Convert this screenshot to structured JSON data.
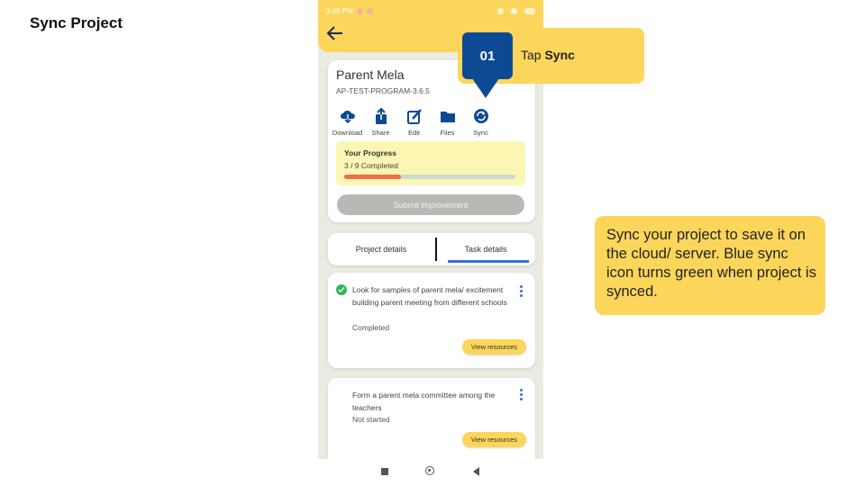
{
  "slide": {
    "title": "Sync Project"
  },
  "statusbar": {
    "time": "3:48 PM"
  },
  "project": {
    "title": "Parent Mela",
    "code": "AP-TEST-PROGRAM-3.6.5",
    "actions": [
      {
        "label": "Download",
        "icon": "cloud-download-icon"
      },
      {
        "label": "Share",
        "icon": "share-icon"
      },
      {
        "label": "Edit",
        "icon": "edit-icon"
      },
      {
        "label": "Files",
        "icon": "folder-icon"
      },
      {
        "label": "Sync",
        "icon": "sync-icon"
      }
    ],
    "progress": {
      "title": "Your Progress",
      "count_text": "3 / 9 Completed",
      "completed": 3,
      "total": 9
    },
    "submit_label": "Submit improvement"
  },
  "tabs": {
    "project": "Project details",
    "task": "Task details",
    "active": "task"
  },
  "tasks": [
    {
      "text": "Look for samples of parent mela/ excitement building parent meeting from different schools",
      "status": "Completed",
      "button": "View resources"
    },
    {
      "text": "Form a parent mela committee among the teachers",
      "status": "Not started",
      "button": "View resources"
    }
  ],
  "callouts": {
    "step_number": "01",
    "step_prefix": "Tap ",
    "step_action": "Sync",
    "info": "Sync your project to save it on the cloud/ server. Blue sync icon turns green when project is synced."
  },
  "colors": {
    "accent": "#fbd65a",
    "primary_blue": "#0e4a94",
    "progress": "#ef6d49",
    "tab_underline": "#3b6fd9",
    "completed": "#2fb565"
  }
}
